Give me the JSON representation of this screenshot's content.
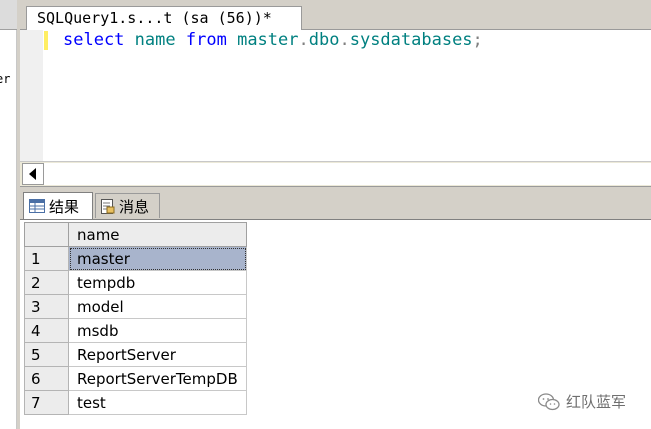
{
  "left_panel": {
    "fragment_text": "er"
  },
  "document_tab": {
    "title": "SQLQuery1.s...t (sa (56))*"
  },
  "editor": {
    "tokens": [
      {
        "text": "select",
        "role": "keyword"
      },
      {
        "text": " ",
        "role": "space"
      },
      {
        "text": "name",
        "role": "column"
      },
      {
        "text": " ",
        "role": "space"
      },
      {
        "text": "from",
        "role": "keyword"
      },
      {
        "text": " ",
        "role": "space"
      },
      {
        "text": "master",
        "role": "table"
      },
      {
        "text": ".",
        "role": "punct"
      },
      {
        "text": "dbo",
        "role": "table"
      },
      {
        "text": ".",
        "role": "punct"
      },
      {
        "text": "sysdatabases",
        "role": "table"
      },
      {
        "text": ";",
        "role": "punct"
      }
    ],
    "colors": {
      "keyword": "#0000ff",
      "column": "#008080",
      "table": "#008080",
      "punct": "#808080",
      "change_marker": "#ffee62"
    }
  },
  "results_tabs": {
    "results": {
      "label": "结果",
      "icon": "grid-icon"
    },
    "messages": {
      "label": "消息",
      "icon": "document-icon"
    }
  },
  "grid": {
    "column": "name",
    "rows": [
      {
        "num": "1",
        "name": "master"
      },
      {
        "num": "2",
        "name": "tempdb"
      },
      {
        "num": "3",
        "name": "model"
      },
      {
        "num": "4",
        "name": "msdb"
      },
      {
        "num": "5",
        "name": "ReportServer"
      },
      {
        "num": "6",
        "name": "ReportServerTempDB"
      },
      {
        "num": "7",
        "name": "test"
      }
    ],
    "selected_row": 0,
    "selection_color": "#a8b4cc"
  },
  "watermark": {
    "text": "红队蓝军",
    "icon": "wechat-icon"
  }
}
